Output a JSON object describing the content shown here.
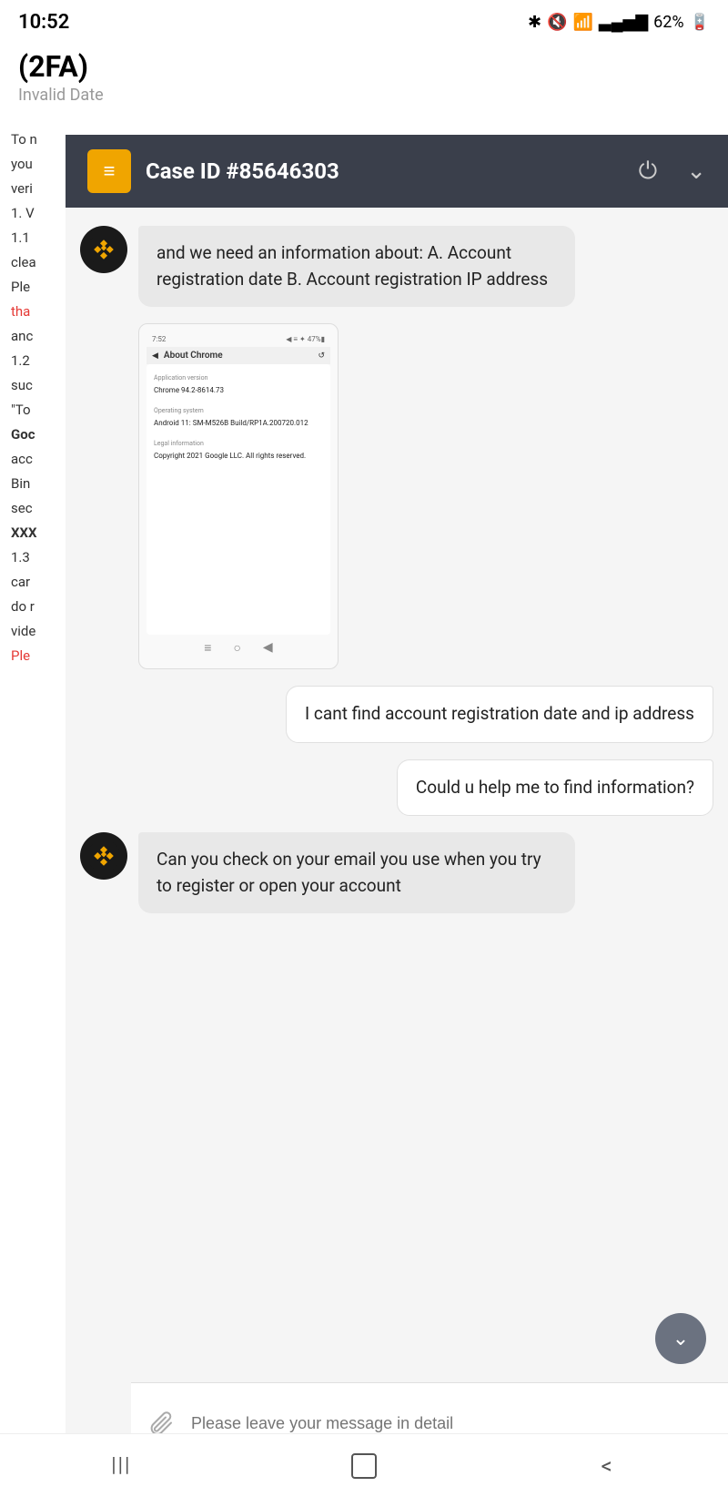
{
  "statusBar": {
    "time": "10:52",
    "battery": "62%",
    "icons": [
      "bluetooth",
      "mute",
      "wifi",
      "signal",
      "battery"
    ]
  },
  "pageHeader": {
    "title": "(2FA)",
    "date": "Invalid Date"
  },
  "chatHeader": {
    "caseId": "Case ID #85646303",
    "iconSymbol": "≡",
    "powerIcon": "⏻",
    "chevronIcon": "∨"
  },
  "messages": [
    {
      "id": "msg1",
      "type": "incoming",
      "avatar": true,
      "text": "and we need an information about: A. Account registration date B. Account registration IP address"
    },
    {
      "id": "msg2",
      "type": "incoming",
      "avatar": false,
      "hasScreenshot": true,
      "screenshotTitle": "About Chrome",
      "screenshotSections": [
        {
          "label": "Application version",
          "value": "Chrome 94.2-8614.73"
        },
        {
          "label": "Operating system",
          "value": "Android 11: SM-M526B Build/RP1A.200720.012"
        },
        {
          "label": "Legal information",
          "value": "Copyright 2021 Google LLC. All rights reserved."
        }
      ]
    },
    {
      "id": "msg3",
      "type": "outgoing",
      "text": "I cant find account registration date and ip address"
    },
    {
      "id": "msg4",
      "type": "outgoing",
      "text": "Could u help me to find information?"
    },
    {
      "id": "msg5",
      "type": "incoming",
      "avatar": true,
      "text": "Can you check on your email you use when you try to register or open your account"
    }
  ],
  "inputBar": {
    "placeholder": "Please leave your message in detail",
    "attachIcon": "📎"
  },
  "bgLines": [
    {
      "text": "To n",
      "style": "normal"
    },
    {
      "text": "you",
      "style": "normal"
    },
    {
      "text": "veri",
      "style": "normal"
    },
    {
      "text": "",
      "style": "normal"
    },
    {
      "text": "1. V",
      "style": "normal"
    },
    {
      "text": "",
      "style": "normal"
    },
    {
      "text": "1.1",
      "style": "normal"
    },
    {
      "text": "",
      "style": "normal"
    },
    {
      "text": "clea",
      "style": "normal"
    },
    {
      "text": "",
      "style": "normal"
    },
    {
      "text": "Ple",
      "style": "normal"
    },
    {
      "text": "tha",
      "style": "red"
    },
    {
      "text": "anc",
      "style": "normal"
    },
    {
      "text": "",
      "style": "normal"
    },
    {
      "text": "1.2",
      "style": "normal"
    },
    {
      "text": "",
      "style": "normal"
    },
    {
      "text": "suc",
      "style": "normal"
    },
    {
      "text": "",
      "style": "normal"
    },
    {
      "text": "\"To",
      "style": "normal"
    },
    {
      "text": "",
      "style": "normal"
    },
    {
      "text": "Goc",
      "style": "bold"
    },
    {
      "text": "acc",
      "style": "normal"
    },
    {
      "text": "Bin",
      "style": "normal"
    },
    {
      "text": "sec",
      "style": "normal"
    },
    {
      "text": "XXX",
      "style": "bold"
    },
    {
      "text": "",
      "style": "normal"
    },
    {
      "text": "1.3",
      "style": "normal"
    },
    {
      "text": "",
      "style": "normal"
    },
    {
      "text": "car",
      "style": "normal"
    },
    {
      "text": "do r",
      "style": "normal"
    },
    {
      "text": "vide",
      "style": "normal"
    },
    {
      "text": "",
      "style": "normal"
    },
    {
      "text": "Ple",
      "style": "red"
    }
  ],
  "navBar": {
    "menuIcon": "|||",
    "homeIcon": "□",
    "backIcon": "<"
  }
}
